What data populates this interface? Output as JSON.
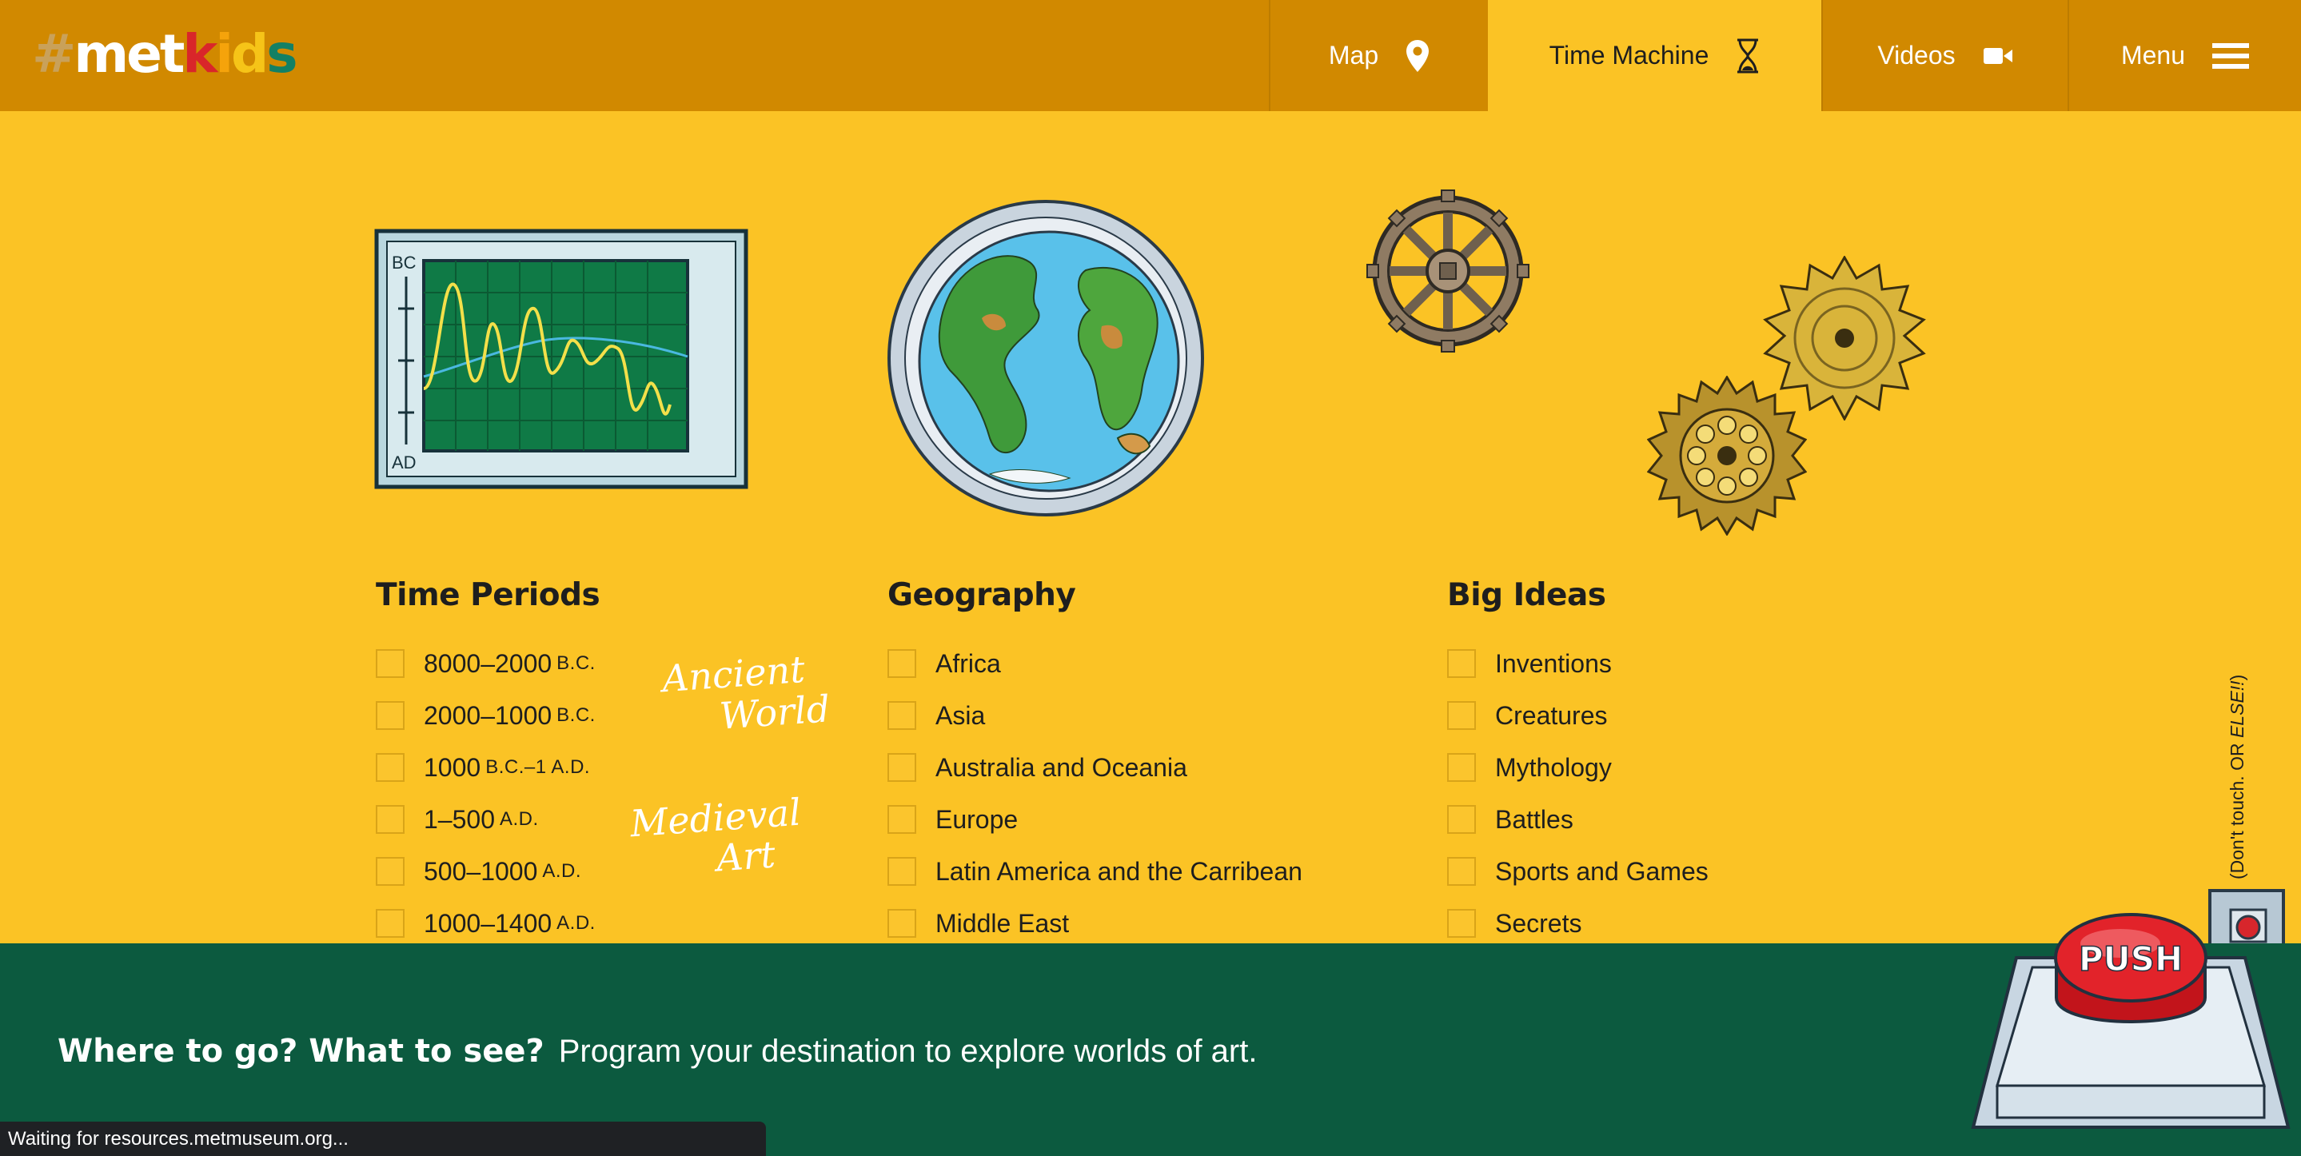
{
  "logo": {
    "hash": "#",
    "letters": [
      {
        "ch": "m",
        "color": "#ffffff"
      },
      {
        "ch": "e",
        "color": "#ffffff"
      },
      {
        "ch": "t",
        "color": "#ffffff"
      },
      {
        "ch": "k",
        "color": "#d9262a"
      },
      {
        "ch": "i",
        "color": "#f5a30b"
      },
      {
        "ch": "d",
        "color": "#f6c418"
      },
      {
        "ch": "s",
        "color": "#138064"
      }
    ]
  },
  "nav": {
    "map": "Map",
    "time_machine": "Time Machine",
    "videos": "Videos",
    "menu": "Menu"
  },
  "columns": {
    "time_periods": {
      "title": "Time Periods",
      "options": [
        {
          "main": "8000–2000",
          "suffix": "B.C."
        },
        {
          "main": "2000–1000",
          "suffix": "B.C."
        },
        {
          "main": "1000",
          "suffix": "B.C.–1 A.D."
        },
        {
          "main": "1–500",
          "suffix": "A.D."
        },
        {
          "main": "500–1000",
          "suffix": "A.D."
        },
        {
          "main": "1000–1400",
          "suffix": "A.D."
        }
      ],
      "annotations": {
        "ancient_1": "Ancient",
        "ancient_2": "World",
        "medieval_1": "Medieval",
        "medieval_2": "Art"
      }
    },
    "geography": {
      "title": "Geography",
      "options": [
        "Africa",
        "Asia",
        "Australia and Oceania",
        "Europe",
        "Latin America and the Carribean",
        "Middle East"
      ]
    },
    "big_ideas": {
      "title": "Big Ideas",
      "options": [
        "Inventions",
        "Creatures",
        "Mythology",
        "Battles",
        "Sports and Games",
        "Secrets"
      ]
    }
  },
  "illustrations": {
    "monitor_top": "BC",
    "monitor_bottom": "AD",
    "push_button": "PUSH"
  },
  "side_note": {
    "normal": "(Don't touch. OR ",
    "italic": "ELSE!!",
    "end": ")"
  },
  "footer": {
    "bold": "Where to go? What to see?",
    "text": "Program your destination to explore worlds of art."
  },
  "status_bar": "Waiting for resources.metmuseum.org...",
  "colors": {
    "background": "#fbc325",
    "topbar": "#d18900",
    "footer": "#0c5a3f",
    "text": "#1e1e1e"
  }
}
